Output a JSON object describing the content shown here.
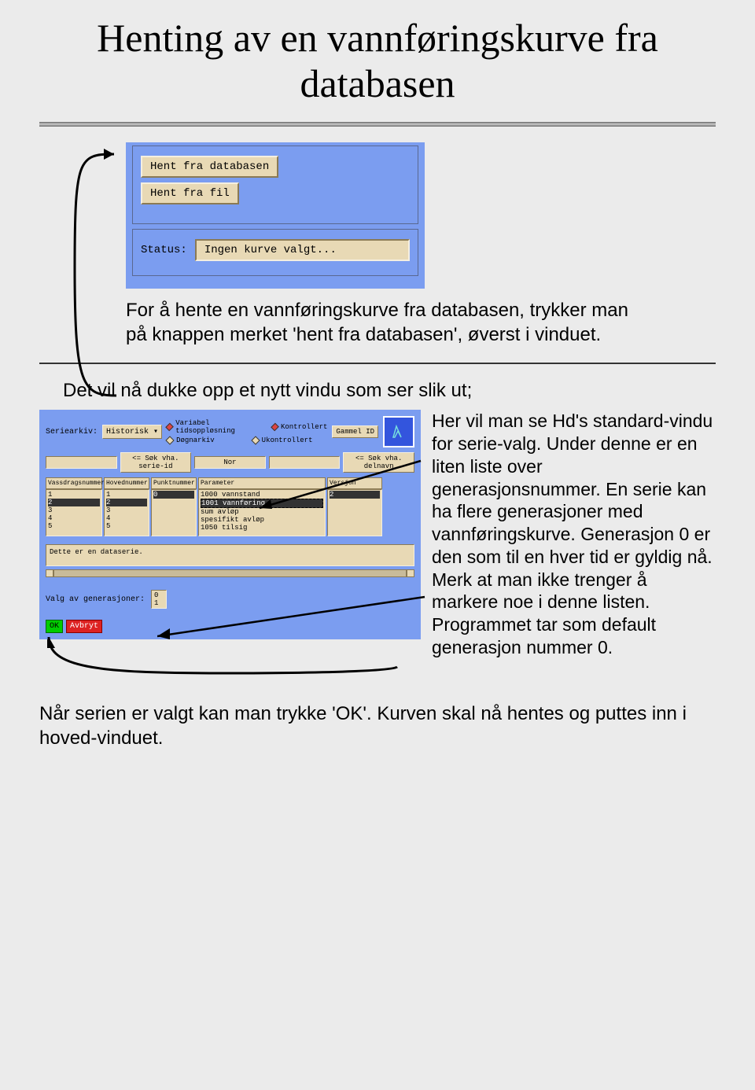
{
  "title": "Henting av en vannføringskurve fra databasen",
  "panel1": {
    "hent_db": "Hent fra databasen",
    "hent_fil": "Hent fra fil",
    "status_label": "Status:",
    "status_value": "Ingen kurve valgt..."
  },
  "text1": "For å hente en vannføringskurve fra databasen, trykker man på knappen merket 'hent fra databasen', øverst i vinduet.",
  "section2_heading": "Det vil nå dukke opp et nytt vindu som ser slik ut;",
  "panel2": {
    "seriearkiv_label": "Seriearkiv:",
    "seriearkiv_value": "Historisk",
    "radio_var": "Variabel tidsoppløsning",
    "radio_dogn": "Døgnarkiv",
    "radio_kontrollert": "Kontrollert",
    "radio_ukontrollert": "Ukontrollert",
    "gammel_id": "Gammel ID",
    "search_serie": "<= Søk vha. serie-id",
    "search_nor": "Nor",
    "search_delnavn": "<= Søk vha. delnavn",
    "headers": {
      "vassdrag": "Vassdragsnummer",
      "hoved": "Hovednummer",
      "punkt": "Punktnummer",
      "param": "Parameter",
      "versjon": "Versjon"
    },
    "list1": [
      "1",
      "2",
      "3",
      "4",
      "5"
    ],
    "list2": [
      "1",
      "2",
      "3",
      "4",
      "5"
    ],
    "list3": [
      "0"
    ],
    "list4": [
      "1000 vannstand",
      "1001 vannføring",
      "     sum avløp",
      "     spesifikt avløp",
      "1050 tilsig"
    ],
    "list5": [
      "2"
    ],
    "desc": "Dette er en dataserie.",
    "gen_label": "Valg av generasjoner:",
    "gen_list": [
      "0",
      "1"
    ],
    "ok": "OK",
    "avbryt": "Avbryt"
  },
  "side_text": "Her vil man se Hd's standard-vindu for serie-valg. Under denne er en liten liste over generasjonsnummer. En serie kan ha flere generasjoner med vannføringskurve. Generasjon 0 er den som til en hver tid er gyldig nå. Merk at man ikke trenger å markere noe i denne listen. Programmet tar som default generasjon nummer 0.",
  "bottom_text": "Når serien er valgt kan man trykke 'OK'. Kurven skal nå hentes og puttes inn i hoved-vinduet."
}
